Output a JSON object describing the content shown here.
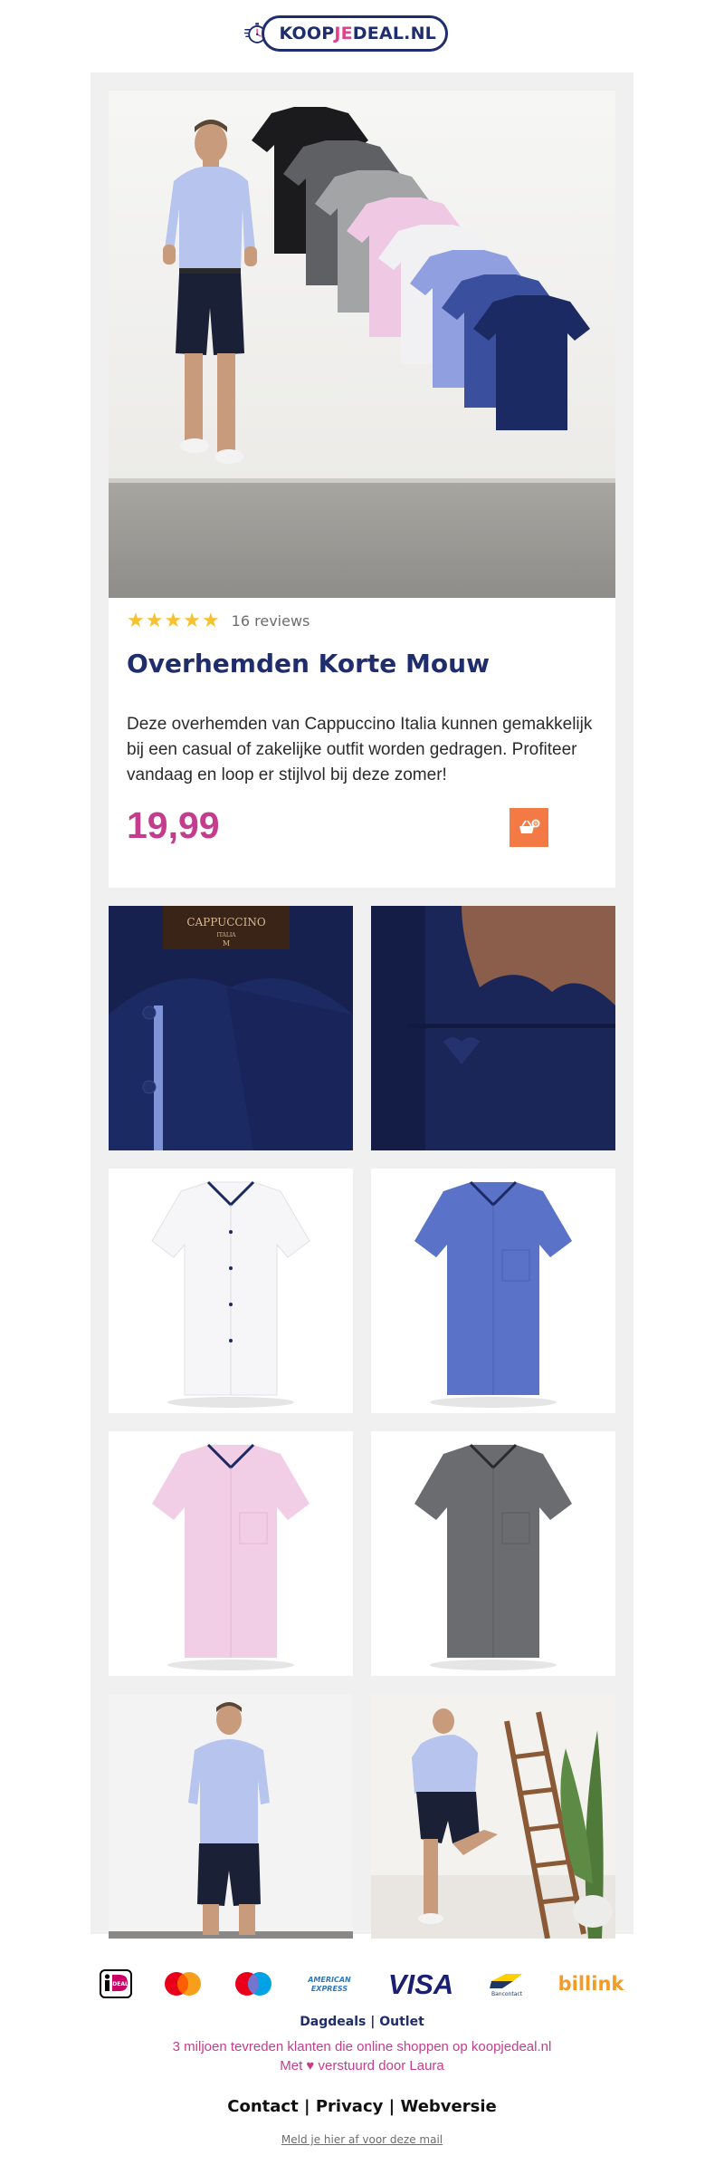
{
  "brand": {
    "logo_text_1": "KOOPJE",
    "logo_text_prefix": "KOOP",
    "logo_text_je": "JE",
    "logo_text_suffix": "DEAL.NL",
    "navy": "#1f2d6d",
    "pink": "#e0408f"
  },
  "product": {
    "rating_stars": 5,
    "reviews_text": "16 reviews",
    "title": "Overhemden Korte Mouw",
    "description": "Deze overhemden van Cappuccino Italia kunnen gemakkelijk bij een casual of zakelijke outfit worden gedragen. Profiteer vandaag en loop er stijlvol bij deze zomer!",
    "price": "19,99",
    "price_color": "#c43d8d",
    "cart_button_color": "#f47a45",
    "collar_label_brand": "CAPPUCCINO",
    "collar_label_sub": "ITALIA",
    "collar_label_size": "M"
  },
  "payment_methods": [
    "iDEAL",
    "Mastercard",
    "Maestro",
    "American Express",
    "VISA",
    "Bancontact",
    "billink"
  ],
  "payment_labels": {
    "ideal": "iDEAL",
    "amex_1": "AMERICAN",
    "amex_2": "EXPRESS",
    "visa": "VISA",
    "bancontact": "Bancontact",
    "billink": "billink"
  },
  "footer": {
    "nav_1": "Dagdeals",
    "nav_sep": "|",
    "nav_2": "Outlet",
    "tagline": "3 miljoen tevreden klanten die online shoppen op koopjedeal.nl",
    "sent_prefix": "Met",
    "sent_suffix": "verstuurd door Laura",
    "heart": "♥",
    "link_contact": "Contact",
    "link_privacy": "Privacy",
    "link_webversie": "Webversie",
    "unsubscribe": "Meld je hier af voor deze mail"
  }
}
